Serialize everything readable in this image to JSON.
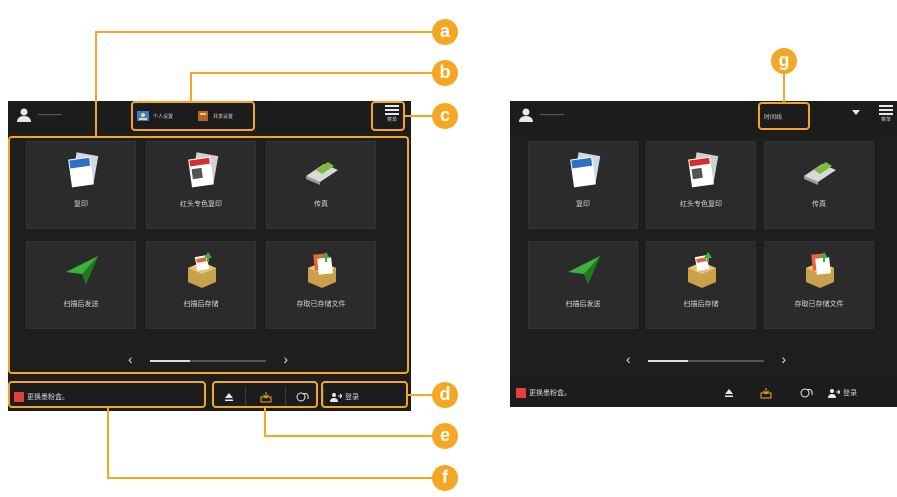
{
  "callouts": [
    "a",
    "b",
    "c",
    "d",
    "e",
    "f",
    "g"
  ],
  "left_screen": {
    "user_name": "———",
    "shortcuts": [
      {
        "icon": "personal-settings-icon",
        "label": "个人设置"
      },
      {
        "icon": "common-settings-icon",
        "label": "共享设置"
      }
    ],
    "menu_label": "菜单",
    "tiles": [
      {
        "icon": "copy-icon",
        "label": "复印"
      },
      {
        "icon": "letterhead-copy-icon",
        "label": "红头专色复印"
      },
      {
        "icon": "fax-icon",
        "label": "传真"
      },
      {
        "icon": "scan-and-send-icon",
        "label": "扫描后发送"
      },
      {
        "icon": "scan-and-store-icon",
        "label": "扫描后存储"
      },
      {
        "icon": "access-stored-files-icon",
        "label": "存取已存储文件"
      }
    ],
    "pager_prev": "‹",
    "pager_next": "›",
    "status_message": "更换墨粉盒。",
    "login_label": "登录"
  },
  "right_screen": {
    "user_name": "———",
    "banner_label": "时间线",
    "menu_label": "菜单",
    "tiles": [
      {
        "icon": "copy-icon",
        "label": "复印"
      },
      {
        "icon": "letterhead-copy-icon",
        "label": "红头专色复印"
      },
      {
        "icon": "fax-icon",
        "label": "传真"
      },
      {
        "icon": "scan-and-send-icon",
        "label": "扫描后发送"
      },
      {
        "icon": "scan-and-store-icon",
        "label": "扫描后存储"
      },
      {
        "icon": "access-stored-files-icon",
        "label": "存取已存储文件"
      }
    ],
    "pager_prev": "‹",
    "pager_next": "›",
    "status_message": "更换墨粉盒。",
    "login_label": "登录"
  },
  "colors": {
    "accent": "#f5a623",
    "screen_bg": "#1e1e1e",
    "tile_bg": "#2b2b2b",
    "error_red": "#e04040"
  }
}
